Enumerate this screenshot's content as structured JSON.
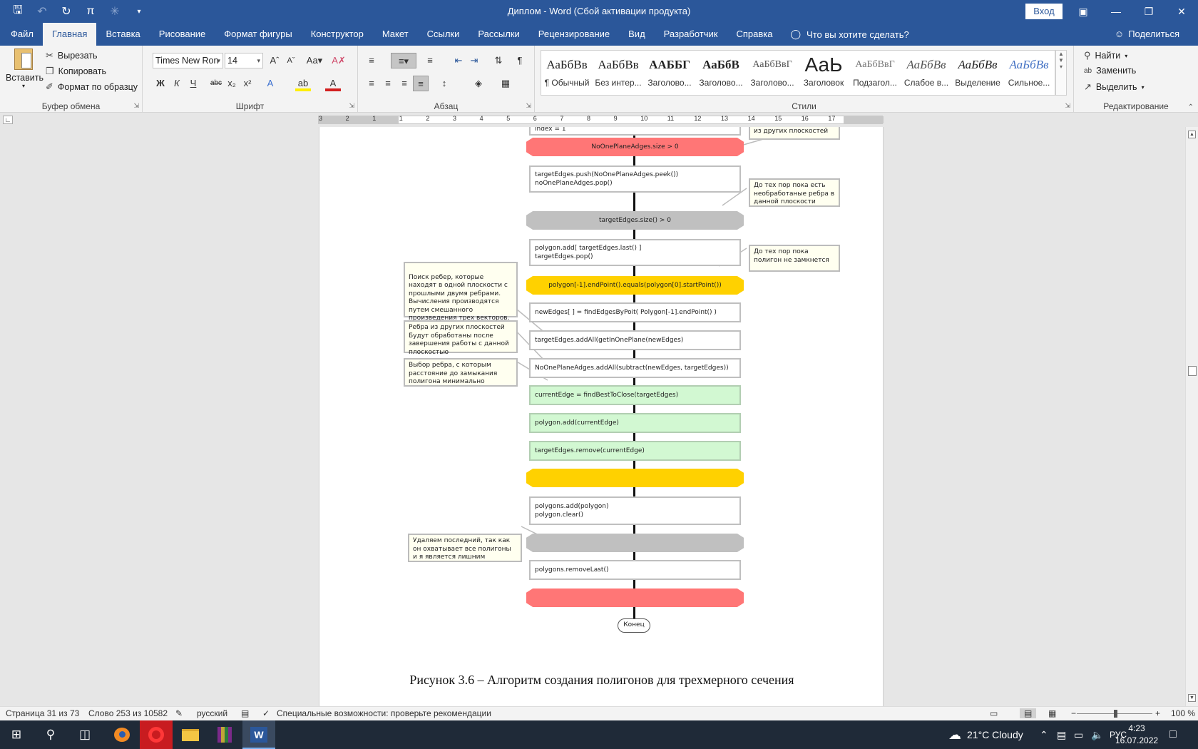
{
  "window": {
    "title": "Диплом  -  Word (Сбой активации продукта)",
    "signin": "Вход"
  },
  "tabs": [
    "Файл",
    "Главная",
    "Вставка",
    "Рисование",
    "Формат фигуры",
    "Конструктор",
    "Макет",
    "Ссылки",
    "Рассылки",
    "Рецензирование",
    "Вид",
    "Разработчик",
    "Справка"
  ],
  "tellme": "Что вы хотите сделать?",
  "share": "Поделиться",
  "clipboard": {
    "paste": "Вставить",
    "cut": "Вырезать",
    "copy": "Копировать",
    "format_painter": "Формат по образцу",
    "label": "Буфер обмена"
  },
  "font": {
    "name": "Times New Ron",
    "size": "14",
    "label": "Шрифт",
    "bold": "Ж",
    "italic": "К",
    "underline": "Ч",
    "strike": "abc",
    "sub": "x₂",
    "sup": "x²"
  },
  "paragraph": {
    "label": "Абзац"
  },
  "styles": {
    "label": "Стили",
    "items": [
      {
        "preview": "АаБбВв",
        "name": "¶ Обычный"
      },
      {
        "preview": "АаБбВв",
        "name": "Без интер..."
      },
      {
        "preview": "ААББГ",
        "name": "Заголово..."
      },
      {
        "preview": "АаБбВ",
        "name": "Заголово..."
      },
      {
        "preview": "АаБбВвГ",
        "name": "Заголово..."
      },
      {
        "preview": "АаЬ",
        "name": "Заголовок"
      },
      {
        "preview": "АаБбВвГ",
        "name": "Подзагол..."
      },
      {
        "preview": "АаБбВв",
        "name": "Слабое в..."
      },
      {
        "preview": "АаБбВв",
        "name": "Выделение"
      },
      {
        "preview": "АаБбВв",
        "name": "Сильное..."
      }
    ]
  },
  "editing": {
    "find": "Найти",
    "replace": "Заменить",
    "select": "Выделить",
    "label": "Редактирование"
  },
  "ruler": {
    "numbers": [
      "3",
      "2",
      "1",
      "1",
      "2",
      "3",
      "4",
      "5",
      "6",
      "7",
      "8",
      "9",
      "10",
      "11",
      "12",
      "13",
      "14",
      "15",
      "16",
      "17"
    ]
  },
  "flowchart": {
    "top_box": "index = 1",
    "top_note": "из других плоскостей",
    "hex1": "NoOnePlaneAdges.size > 0",
    "box1": [
      "targetEdges.push(NoOnePlaneAdges.peek())",
      "noOnePlaneAdges.pop()"
    ],
    "note1": "До тех пор пока есть необработаные ребра в данной плоскости",
    "hex2": "targetEdges.size() > 0",
    "box2": [
      "polygon.add[ targetEdges.last() ]",
      "targetEdges.pop()"
    ],
    "note2": "До тех пор пока полигон не замкнется",
    "hex3": "polygon[-1].endPoint().equals(polygon[0].startPoint())",
    "note3": "Поиск ребер, которые находят в одной плоскости с прошлыми двумя ребрами.\nВычисления производятся путем смешанного произведения трех векторов.",
    "box3": "newEdges[ ] = findEdgesByPoit( Polygon[-1].endPoint() )",
    "note4": "Ребра из других плоскостей Будут обработаны после завершения работы с данной плоскостью",
    "box4": "targetEdges.addAll(getInOnePlane(newEdges)",
    "box5": "NoOnePlaneAdges.addAll(subtract(newEdges, targetEdges))",
    "note5": "Выбор ребра, с которым расстояние до замыкания полигона минимально",
    "box6": "currentEdge = findBestToClose(targetEdges)",
    "box7": "polygon.add(currentEdge)",
    "box8": "targetEdges.remove(currentEdge)",
    "box9": [
      "polygons.add(polygon)",
      "polygon.clear()"
    ],
    "note6": "Удаляем последний, так как он охватывает все полигоны и я является лишним",
    "box10": "polygons.removeLast()",
    "end": "Конец"
  },
  "caption": "Рисунок 3.6 – Алгоритм создания полигонов для трехмерного сечения",
  "status": {
    "page": "Страница 31 из 73",
    "words": "Слово 253 из 10582",
    "lang": "русский",
    "accessibility": "Специальные возможности: проверьте рекомендации",
    "zoom": "100 %"
  },
  "taskbar": {
    "weather": "21°C  Cloudy",
    "lang": "РУС",
    "time": "4:23",
    "date": "16.07.2022"
  }
}
